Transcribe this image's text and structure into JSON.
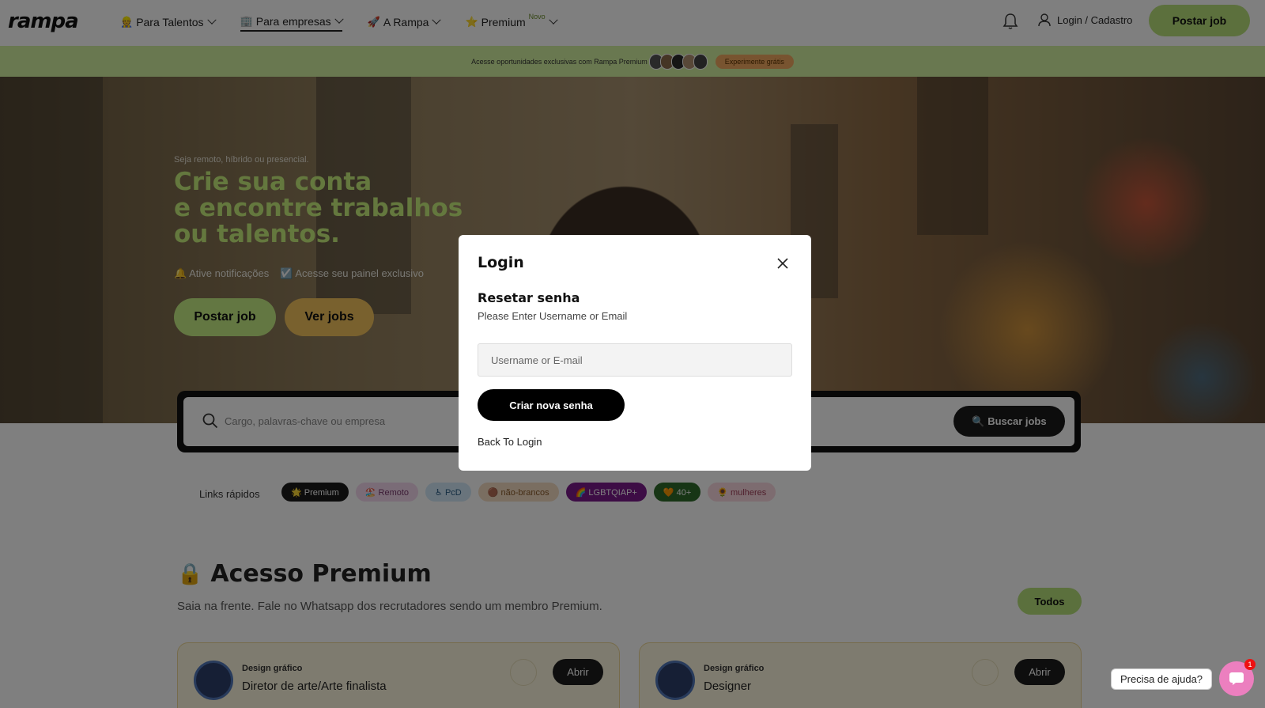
{
  "header": {
    "logo": "rampa",
    "nav": [
      {
        "emoji": "👷",
        "label": "Para Talentos"
      },
      {
        "emoji": "🏢",
        "label": "Para empresas"
      },
      {
        "emoji": "🚀",
        "label": "A Rampa"
      },
      {
        "emoji": "⭐",
        "label": "Premium",
        "badge": "Novo"
      }
    ],
    "login_label": "Login / Cadastro",
    "post_job_label": "Postar job"
  },
  "banner": {
    "text": "Acesse oportunidades exclusivas com Rampa Premium",
    "trial_label": "Experimente grátis"
  },
  "hero": {
    "subtitle": "Seja remoto, híbrido ou presencial.",
    "title_line1": "Crie sua conta",
    "title_line2": "e encontre trabalhos",
    "title_line3": "ou talentos.",
    "feature1": "🔔 Ative notificações",
    "feature2": "☑️ Acesse seu painel exclusivo",
    "post_job_label": "Postar job",
    "see_jobs_label": "Ver jobs"
  },
  "search": {
    "placeholder": "Cargo, palavras-chave ou empresa",
    "button_label": "🔍 Buscar jobs"
  },
  "quick_links": {
    "label": "Links rápidos",
    "chips": [
      {
        "label": "🌟 Premium",
        "bg": "#1b1b1b",
        "fg": "#ffffff"
      },
      {
        "label": "🏖️ Remoto",
        "bg": "#f4d8ee",
        "fg": "#7a3a6e"
      },
      {
        "label": "♿ PcD",
        "bg": "#d2e9f8",
        "fg": "#2a5d85"
      },
      {
        "label": "🟤 não-brancos",
        "bg": "#f4dcc2",
        "fg": "#8a5a2a"
      },
      {
        "label": "🌈 LGBTQIAP+",
        "bg": "#7a1a8a",
        "fg": "#ffffff"
      },
      {
        "label": "🧡 40+",
        "bg": "#2f6b2a",
        "fg": "#ffffff"
      },
      {
        "label": "🌻 mulheres",
        "bg": "#fbd9e0",
        "fg": "#a0405a"
      }
    ]
  },
  "premium": {
    "lock": "🔒",
    "title": "Acesso Premium",
    "subtitle": "Saia na frente. Fale no Whatsapp dos recrutadores sendo um membro Premium.",
    "all_label": "Todos",
    "jobs": [
      {
        "category": "Design gráfico",
        "title": "Diretor de arte/Arte finalista",
        "open_label": "Abrir"
      },
      {
        "category": "Design gráfico",
        "title": "Designer",
        "open_label": "Abrir"
      }
    ]
  },
  "help": {
    "bubble": "Precisa de ajuda?",
    "badge_count": "1"
  },
  "modal": {
    "title": "Login",
    "reset_heading": "Resetar senha",
    "reset_desc": "Please Enter Username or Email",
    "input_placeholder": "Username or E-mail",
    "submit_label": "Criar nova senha",
    "back_label": "Back To Login"
  }
}
